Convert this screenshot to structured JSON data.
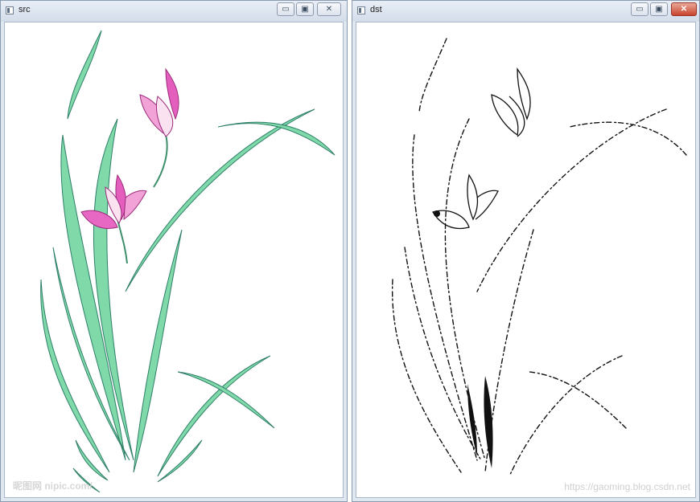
{
  "windows": {
    "src": {
      "title": "src",
      "watermark": "昵图网 nipic.com/"
    },
    "dst": {
      "title": "dst",
      "watermark": "https://gaoming.blog.csdn.net"
    }
  },
  "controls": {
    "minimize": "▭",
    "maximize": "▣",
    "close": "✕"
  },
  "colors": {
    "leaf": "#5ecf9a",
    "leaf_dark": "#2e8a7a",
    "petal": "#e04fb6",
    "ink": "#111111"
  }
}
